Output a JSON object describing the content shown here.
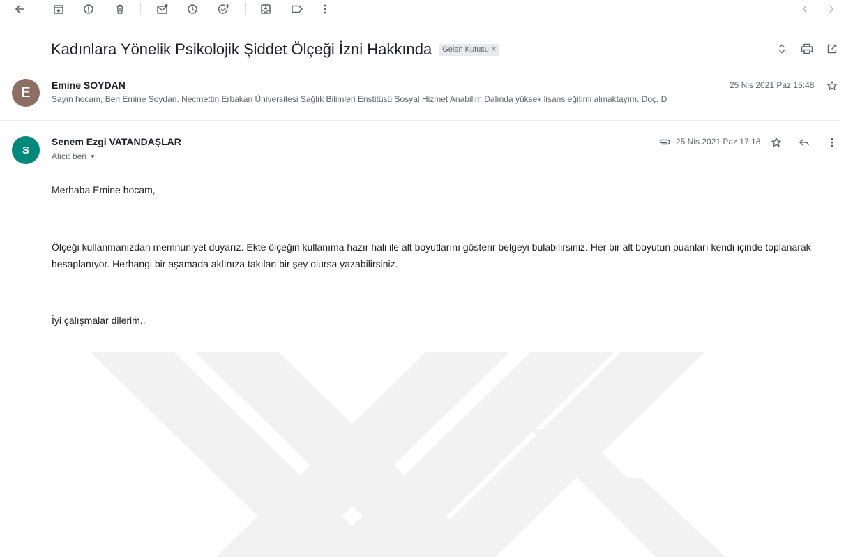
{
  "toolbar": {
    "icons": [
      "back-arrow-icon",
      "archive-icon",
      "report-spam-icon",
      "delete-icon",
      "mark-unread-icon",
      "snooze-icon",
      "add-task-icon",
      "move-to-icon",
      "label-icon",
      "more-vert-icon",
      "prev-icon",
      "next-icon"
    ]
  },
  "subject": "Kadınlara Yönelik Psikolojik Şiddet Ölçeği İzni Hakkında",
  "label_chip": {
    "text": "Gelen Kutusu",
    "close": "×"
  },
  "messages": [
    {
      "avatar_letter": "E",
      "avatar_color": "#8d6e63",
      "sender": "Emine SOYDAN",
      "snippet": "Sayın hocam, Ben Emine Soydan. Necmettin Erbakan Üniversitesi Sağlık Bilimleri Enstitüsü Sosyal Hizmet Anabilim Dalında yüksek lisans eğitimi almaktayım. Doç. D",
      "date": "25 Nis 2021 Paz 15:48"
    },
    {
      "avatar_letter": "S",
      "avatar_color": "#00897b",
      "sender": "Senem Ezgi VATANDAŞLAR",
      "recipient": "Alıcı: ben",
      "date": "25 Nis 2021 Paz 17:18",
      "body": {
        "greeting": "Merhaba Emine hocam,",
        "paragraph": "Ölçeği kullanmanızdan memnuniyet duyarız. Ekte ölçeğin kullanıma hazır hali ile alt boyutlarını gösterir belgeyi bulabilirsiniz. Her bir alt boyutun puanları kendi içinde toplanarak hesaplanıyor. Herhangi bir aşamada aklınıza takılan bir şey olursa yazabilirsiniz.",
        "closing": "İyi çalışmalar dilerim.."
      }
    }
  ]
}
